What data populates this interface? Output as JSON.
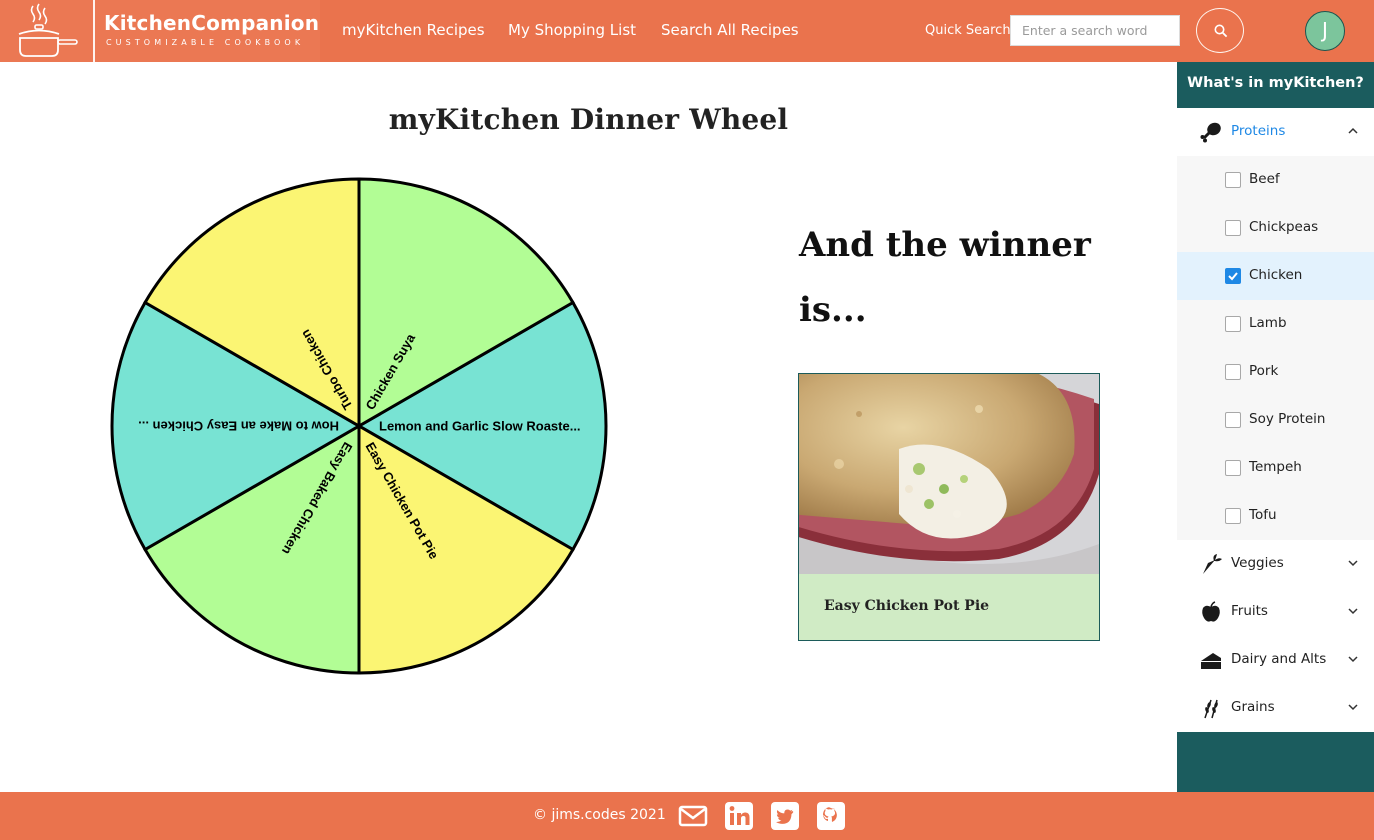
{
  "header": {
    "brand_name": "KitchenCompanion",
    "brand_tagline": "CUSTOMIZABLE COOKBOOK",
    "nav": [
      "myKitchen Recipes",
      "My Shopping List",
      "Search All Recipes"
    ],
    "quick_search_label": "Quick Search",
    "search_placeholder": "Enter a search word",
    "search_value": "",
    "avatar_initial": "J"
  },
  "main": {
    "title": "myKitchen Dinner Wheel",
    "wheel_segments": [
      {
        "label": "Lemon and Garlic Slow Roaste...",
        "color": "#78e3d3"
      },
      {
        "label": "Easy Chicken Pot Pie",
        "color": "#fbf573"
      },
      {
        "label": "Easy Baked Chicken",
        "color": "#b2fd95"
      },
      {
        "label": "How to Make an Easy Chicken ...",
        "color": "#78e3d3"
      },
      {
        "label": "Turbo Chicken",
        "color": "#fbf573"
      },
      {
        "label": "Chicken Suya",
        "color": "#b2fd95"
      }
    ],
    "winner_heading": "And the winner is...",
    "winner_recipe": "Easy Chicken Pot Pie"
  },
  "sidebar": {
    "title": "What's in myKitchen?",
    "categories": [
      {
        "label": "Proteins",
        "icon": "drumstick-icon",
        "expanded": true,
        "items": [
          {
            "label": "Beef",
            "checked": false
          },
          {
            "label": "Chickpeas",
            "checked": false
          },
          {
            "label": "Chicken",
            "checked": true
          },
          {
            "label": "Lamb",
            "checked": false
          },
          {
            "label": "Pork",
            "checked": false
          },
          {
            "label": "Soy Protein",
            "checked": false
          },
          {
            "label": "Tempeh",
            "checked": false
          },
          {
            "label": "Tofu",
            "checked": false
          }
        ]
      },
      {
        "label": "Veggies",
        "icon": "carrot-icon",
        "expanded": false
      },
      {
        "label": "Fruits",
        "icon": "apple-icon",
        "expanded": false
      },
      {
        "label": "Dairy and Alts",
        "icon": "cheese-icon",
        "expanded": false
      },
      {
        "label": "Grains",
        "icon": "wheat-icon",
        "expanded": false
      }
    ]
  },
  "footer": {
    "copyright": "© jims.codes 2021",
    "social": [
      "mail-icon",
      "linkedin-icon",
      "twitter-icon",
      "github-icon"
    ]
  },
  "colors": {
    "navbar": "#ea734d",
    "sidebar": "#1b5c5e",
    "active": "#1e88e5",
    "card": "#d0ebc5"
  }
}
